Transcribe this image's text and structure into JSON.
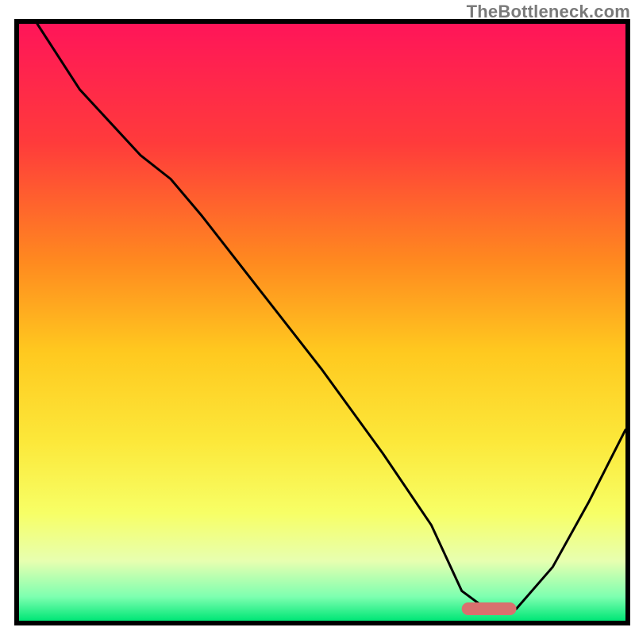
{
  "watermark": "TheBottleneck.com",
  "chart_data": {
    "type": "line",
    "title": "",
    "xlabel": "",
    "ylabel": "",
    "xlim": [
      0,
      100
    ],
    "ylim": [
      0,
      100
    ],
    "curve_minimum_x": 77,
    "marker": {
      "x_start": 73,
      "x_end": 82,
      "y": 2
    },
    "x": [
      3,
      10,
      20,
      25,
      30,
      40,
      50,
      60,
      68,
      73,
      77,
      82,
      88,
      94,
      100
    ],
    "values": [
      100,
      89,
      78,
      74,
      68,
      55,
      42,
      28,
      16,
      5,
      2,
      2,
      9,
      20,
      32
    ],
    "gradient_stops": [
      {
        "offset": 0.0,
        "color": "#ff1559"
      },
      {
        "offset": 0.2,
        "color": "#ff3b3b"
      },
      {
        "offset": 0.4,
        "color": "#ff8a1f"
      },
      {
        "offset": 0.55,
        "color": "#ffc91f"
      },
      {
        "offset": 0.7,
        "color": "#fce83a"
      },
      {
        "offset": 0.82,
        "color": "#f7ff66"
      },
      {
        "offset": 0.9,
        "color": "#e7ffb0"
      },
      {
        "offset": 0.96,
        "color": "#7dffb0"
      },
      {
        "offset": 1.0,
        "color": "#00e676"
      }
    ]
  }
}
